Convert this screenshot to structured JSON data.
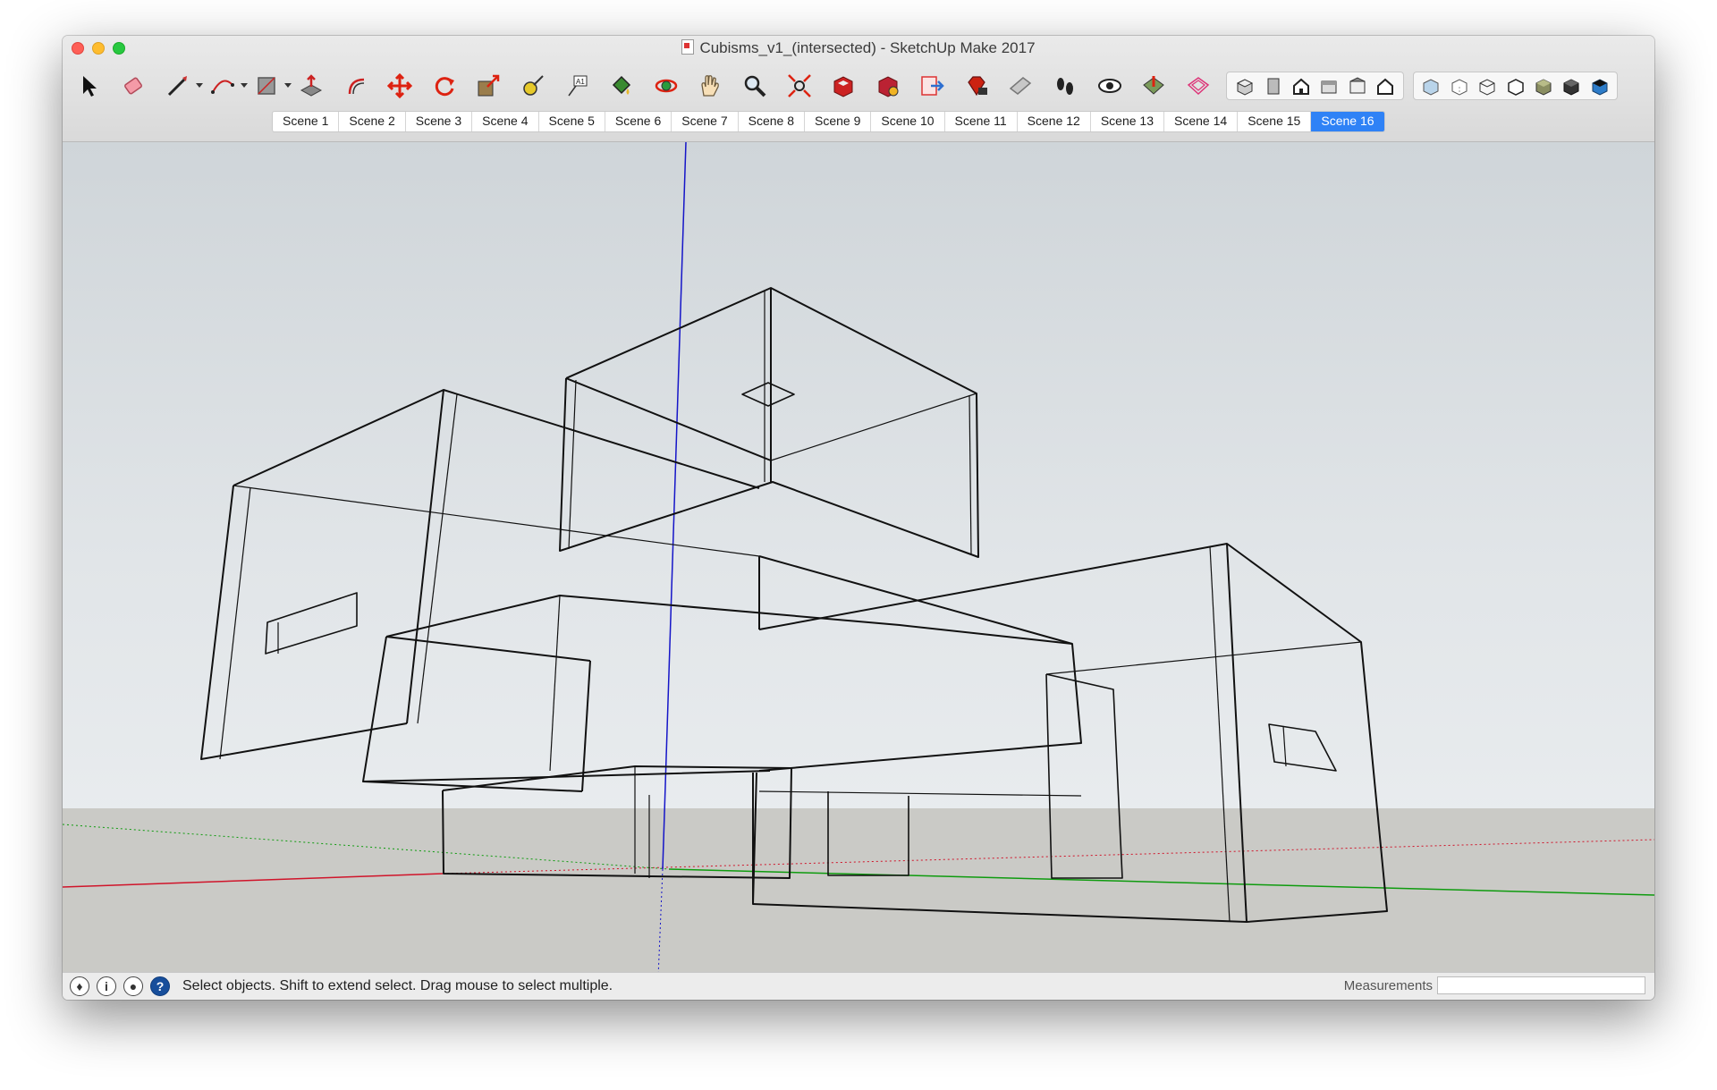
{
  "window": {
    "title": "Cubisms_v1_(intersected) - SketchUp Make 2017"
  },
  "toolbar": {
    "tools": [
      {
        "name": "select-icon",
        "dropdown": false
      },
      {
        "name": "eraser-icon",
        "dropdown": false
      },
      {
        "name": "pencil-line-icon",
        "dropdown": true
      },
      {
        "name": "arc-icon",
        "dropdown": true
      },
      {
        "name": "rectangle-icon",
        "dropdown": true
      },
      {
        "name": "push-pull-icon",
        "dropdown": false
      },
      {
        "name": "offset-icon",
        "dropdown": false
      },
      {
        "name": "move-icon",
        "dropdown": false
      },
      {
        "name": "rotate-icon",
        "dropdown": false
      },
      {
        "name": "scale-icon",
        "dropdown": false
      },
      {
        "name": "tape-measure-icon",
        "dropdown": false
      },
      {
        "name": "text-icon",
        "dropdown": false
      },
      {
        "name": "paint-bucket-icon",
        "dropdown": false
      },
      {
        "name": "orbit-icon",
        "dropdown": false
      },
      {
        "name": "pan-icon",
        "dropdown": false
      },
      {
        "name": "zoom-icon",
        "dropdown": false
      },
      {
        "name": "zoom-extents-icon",
        "dropdown": false
      },
      {
        "name": "3d-warehouse-icon",
        "dropdown": false
      },
      {
        "name": "extension-warehouse-icon",
        "dropdown": false
      },
      {
        "name": "send-to-layout-icon",
        "dropdown": false
      },
      {
        "name": "ruby-console-icon",
        "dropdown": false
      },
      {
        "name": "section-plane-icon",
        "dropdown": false
      },
      {
        "name": "walk-icon",
        "dropdown": false
      },
      {
        "name": "look-around-icon",
        "dropdown": false
      },
      {
        "name": "add-location-icon",
        "dropdown": false
      },
      {
        "name": "toggle-terrain-icon",
        "dropdown": false
      }
    ],
    "view_tools": [
      "iso-view-icon",
      "top-view-icon",
      "front-view-icon",
      "right-view-icon",
      "back-view-icon",
      "left-view-icon"
    ],
    "style_tools": [
      "xray-icon",
      "back-edges-icon",
      "wireframe-icon",
      "hidden-line-icon",
      "shaded-icon",
      "shaded-textures-icon",
      "monochrome-icon"
    ]
  },
  "scenes": [
    "Scene 1",
    "Scene 2",
    "Scene 3",
    "Scene 4",
    "Scene 5",
    "Scene 6",
    "Scene 7",
    "Scene 8",
    "Scene 9",
    "Scene 10",
    "Scene 11",
    "Scene 12",
    "Scene 13",
    "Scene 14",
    "Scene 15",
    "Scene 16"
  ],
  "active_scene": "Scene 16",
  "status": {
    "message": "Select objects. Shift to extend select. Drag mouse to select multiple.",
    "measurements_label": "Measurements",
    "measurements_value": ""
  },
  "colors": {
    "active_tab": "#2f82f6",
    "axis_red": "#d0142a",
    "axis_green": "#0e9b0e",
    "axis_blue": "#1515c8",
    "sky": "#dfe4e7",
    "ground": "#cacac6"
  }
}
